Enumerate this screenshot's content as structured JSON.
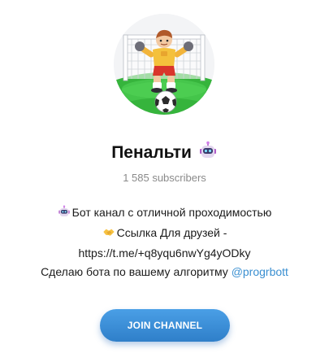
{
  "channel": {
    "name": "Пенальти",
    "subscribers": "1 585 subscribers"
  },
  "description": {
    "line1": "Бот канал с отличной проходимостью",
    "line2": "Ссылка Для друзей -",
    "line3": "https://t.me/+q8yqu6nwYg4yODky",
    "line4_text": "Сделаю бота по вашему алгоритму ",
    "line4_link": "@progrbott"
  },
  "join_button": {
    "label": "JOIN CHANNEL"
  },
  "colors": {
    "accent": "#3a8fd1",
    "button": "#3a8ed8",
    "pitch": "#3dbb3f"
  },
  "icons": {
    "title_emoji": "robot-icon",
    "line1_emoji": "robot-icon",
    "line2_emoji": "handshake-icon",
    "avatar": "goalkeeper-penalty-icon"
  }
}
